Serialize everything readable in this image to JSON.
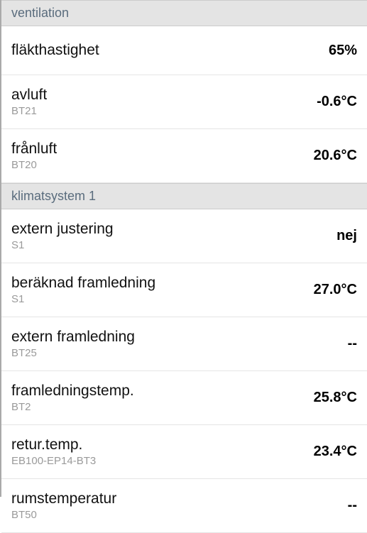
{
  "sections": {
    "ventilation": {
      "title": "ventilation",
      "rows": {
        "fan_speed": {
          "label": "fläkthastighet",
          "sublabel": "",
          "value": "65%"
        },
        "exhaust_air": {
          "label": "avluft",
          "sublabel": "BT21",
          "value": "-0.6°C"
        },
        "extract_air": {
          "label": "frånluft",
          "sublabel": "BT20",
          "value": "20.6°C"
        }
      }
    },
    "climate1": {
      "title": "klimatsystem 1",
      "rows": {
        "external_adjustment": {
          "label": "extern justering",
          "sublabel": "S1",
          "value": "nej"
        },
        "calculated_supply": {
          "label": "beräknad framledning",
          "sublabel": "S1",
          "value": "27.0°C"
        },
        "external_supply": {
          "label": "extern framledning",
          "sublabel": "BT25",
          "value": "--"
        },
        "supply_temp": {
          "label": "framledningstemp.",
          "sublabel": "BT2",
          "value": "25.8°C"
        },
        "return_temp": {
          "label": "retur.temp.",
          "sublabel": "EB100-EP14-BT3",
          "value": "23.4°C"
        },
        "room_temp": {
          "label": "rumstemperatur",
          "sublabel": "BT50",
          "value": "--"
        }
      }
    }
  }
}
